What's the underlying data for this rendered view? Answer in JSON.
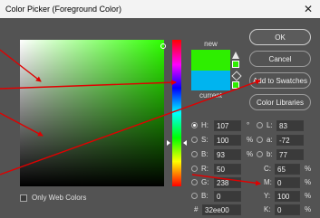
{
  "dialog": {
    "title": "Color Picker (Foreground Color)",
    "close_glyph": "✕"
  },
  "swatch": {
    "new_label": "new",
    "current_label": "current",
    "new_color": "#2eee00",
    "current_color": "#00b4ef"
  },
  "buttons": {
    "ok": "OK",
    "cancel": "Cancel",
    "add": "Add to Swatches",
    "libraries": "Color Libraries"
  },
  "fields": {
    "H": {
      "label": "H:",
      "value": "107",
      "unit": "°"
    },
    "S": {
      "label": "S:",
      "value": "100",
      "unit": "%"
    },
    "B": {
      "label": "B:",
      "value": "93",
      "unit": "%"
    },
    "R": {
      "label": "R:",
      "value": "50",
      "unit": ""
    },
    "G": {
      "label": "G:",
      "value": "238",
      "unit": ""
    },
    "Bl": {
      "label": "B:",
      "value": "0",
      "unit": ""
    },
    "L": {
      "label": "L:",
      "value": "83",
      "unit": ""
    },
    "a": {
      "label": "a:",
      "value": "-72",
      "unit": ""
    },
    "b": {
      "label": "b:",
      "value": "77",
      "unit": ""
    },
    "C": {
      "label": "C:",
      "value": "65",
      "unit": "%"
    },
    "M": {
      "label": "M:",
      "value": "0",
      "unit": "%"
    },
    "Y": {
      "label": "Y:",
      "value": "100",
      "unit": "%"
    },
    "K": {
      "label": "K:",
      "value": "0",
      "unit": "%"
    },
    "hex": {
      "label": "#",
      "value": "32ee00"
    }
  },
  "web_colors": {
    "label": "Only Web Colors",
    "checked": false
  },
  "annotation_color": "#e00000",
  "icons": {
    "gamut": "warning-triangle-icon",
    "web_safe": "cube-icon"
  }
}
